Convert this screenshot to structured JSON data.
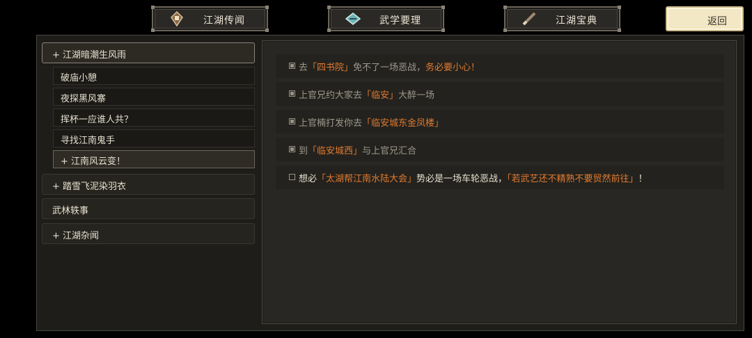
{
  "tabs": [
    {
      "label": "江湖传闻",
      "icon": "scroll-icon"
    },
    {
      "label": "武学要理",
      "icon": "manual-icon"
    },
    {
      "label": "江湖宝典",
      "icon": "brush-icon"
    }
  ],
  "back_button": {
    "label": "返回"
  },
  "colors": {
    "highlight": "#e27a2f",
    "text_done": "#9f998c",
    "text_normal": "#e6e0cf"
  },
  "categories": [
    {
      "label": "+ 江湖暗潮生风雨",
      "subitems": [
        "破庙小憩",
        "夜探黑风寨",
        "挥杯一应谁人共？",
        "寻找江南鬼手",
        "+ 江南风云变！"
      ]
    },
    {
      "label": "+ 踏雪飞泥染羽衣"
    },
    {
      "label": "武林轶事"
    },
    {
      "label": "+ 江湖杂闻"
    }
  ],
  "tasks": [
    {
      "done": true,
      "parts": [
        "去",
        "「四书院」",
        "免不了一场恶战，",
        "务必要小心！",
        ""
      ]
    },
    {
      "done": true,
      "parts": [
        "上官兄约大家去",
        "「临安」",
        "大醉一场",
        "",
        ""
      ]
    },
    {
      "done": true,
      "parts": [
        "上官楠打发你去",
        "「临安城东金凤楼」",
        "",
        "",
        ""
      ]
    },
    {
      "done": true,
      "parts": [
        "到",
        "「临安城西」",
        "与上官兄汇合",
        "",
        ""
      ]
    },
    {
      "done": false,
      "parts": [
        "想必",
        "「太湖帮江南水陆大会」",
        "势必是一场车轮恶战，",
        "「若武艺还不精熟不要贸然前往」",
        "！"
      ]
    }
  ]
}
